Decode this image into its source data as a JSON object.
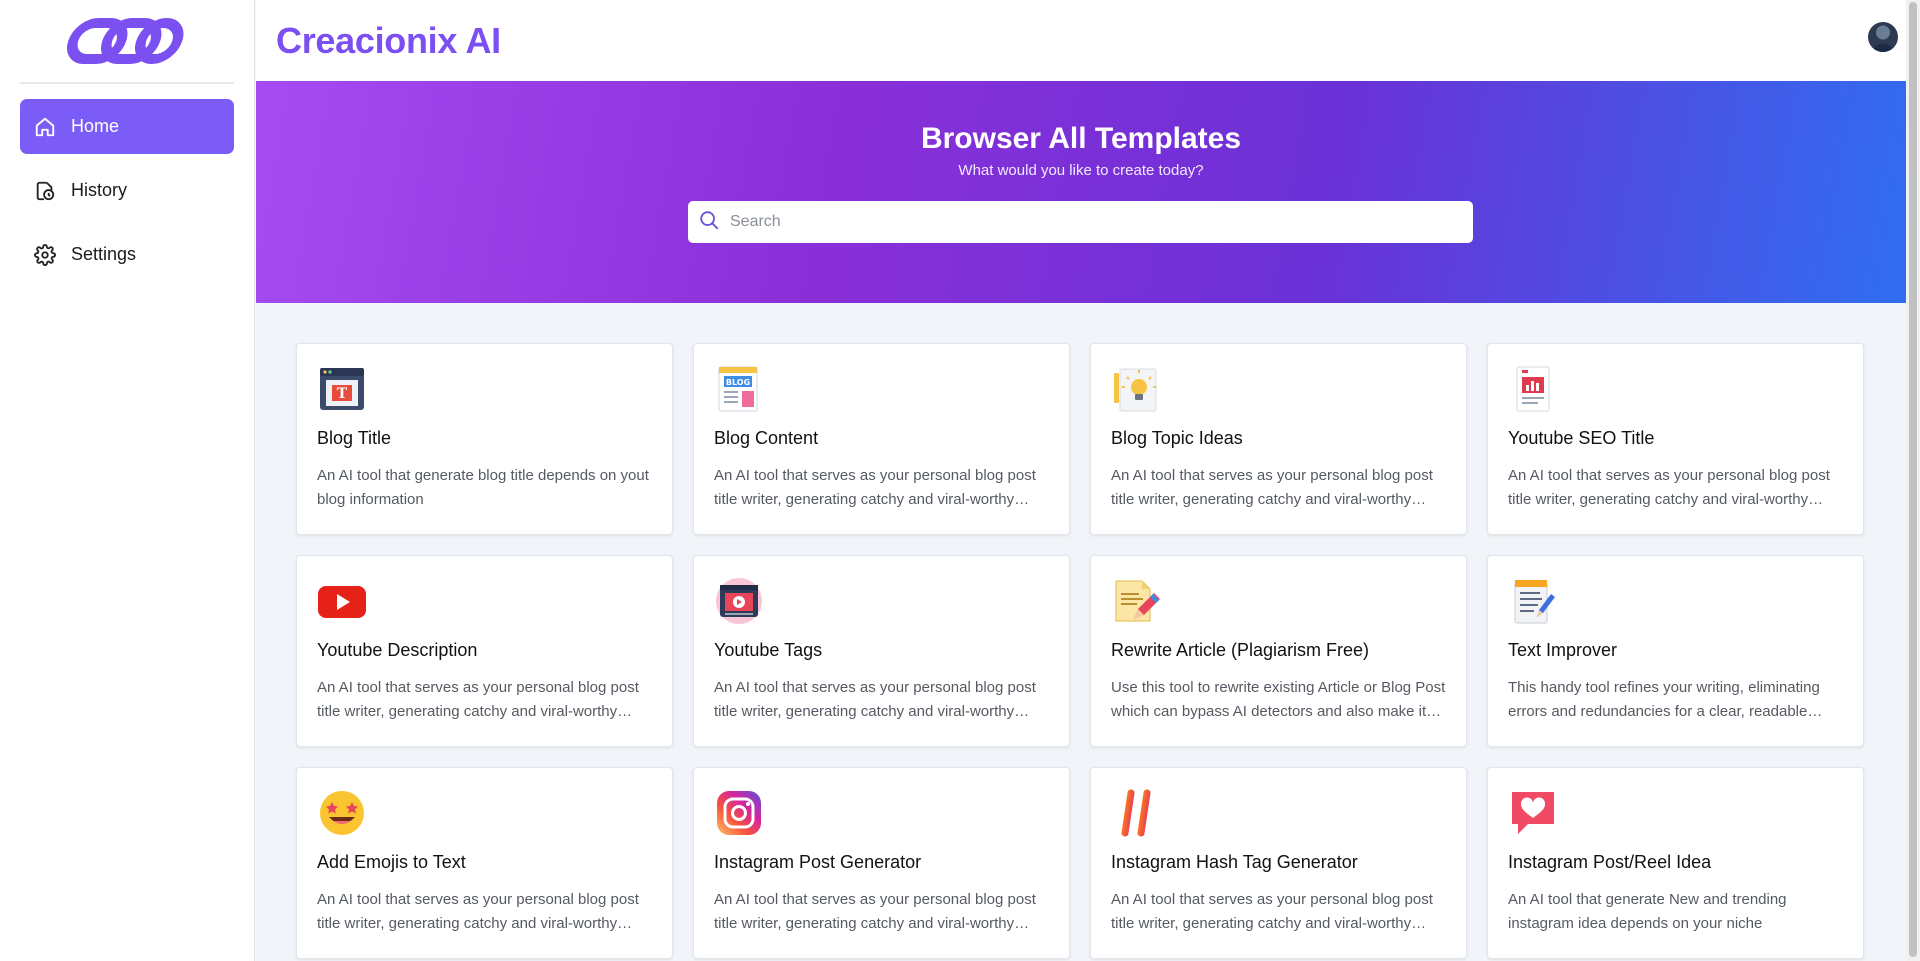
{
  "app": {
    "name": "Creacionix AI"
  },
  "sidebar": {
    "items": [
      {
        "label": "Home",
        "icon": "home-icon",
        "active": true
      },
      {
        "label": "History",
        "icon": "history-icon",
        "active": false
      },
      {
        "label": "Settings",
        "icon": "gear-icon",
        "active": false
      }
    ]
  },
  "hero": {
    "title": "Browser All Templates",
    "subtitle": "What would you like to create today?",
    "search_placeholder": "Search"
  },
  "templates": [
    {
      "title": "Blog Title",
      "desc": "An AI tool that generate blog title depends on yout blog information",
      "icon": "blog-title-icon"
    },
    {
      "title": "Blog Content",
      "desc": "An AI tool that serves as your personal blog post title writer, generating catchy and viral-worthy titles in your chosen language.",
      "icon": "blog-content-icon"
    },
    {
      "title": "Blog Topic Ideas",
      "desc": "An AI tool that serves as your personal blog post title writer, generating catchy and viral-worthy titles in your chosen language.",
      "icon": "lightbulb-icon"
    },
    {
      "title": "Youtube SEO Title",
      "desc": "An AI tool that serves as your personal blog post title writer, generating catchy and viral-worthy titles in your chosen language.",
      "icon": "seo-report-icon"
    },
    {
      "title": "Youtube Description",
      "desc": "An AI tool that serves as your personal blog post title writer, generating catchy and viral-worthy titles in your chosen language.",
      "icon": "youtube-icon"
    },
    {
      "title": "Youtube Tags",
      "desc": "An AI tool that serves as your personal blog post title writer, generating catchy and viral-worthy titles in your chosen language.",
      "icon": "video-tags-icon"
    },
    {
      "title": "Rewrite Article (Plagiarism Free)",
      "desc": "Use this tool to rewrite existing Article or Blog Post which can bypass AI detectors and also make it plagiarism free.",
      "icon": "pencil-document-icon"
    },
    {
      "title": "Text Improver",
      "desc": "This handy tool refines your writing, eliminating errors and redundancies for a clear, readable result.",
      "icon": "notepad-pencil-icon"
    },
    {
      "title": "Add Emojis to Text",
      "desc": "An AI tool that serves as your personal blog post title writer, generating catchy and viral-worthy titles in your chosen language.",
      "icon": "star-eyes-emoji-icon"
    },
    {
      "title": "Instagram Post Generator",
      "desc": "An AI tool that serves as your personal blog post title writer, generating catchy and viral-worthy titles in your chosen language.",
      "icon": "instagram-icon"
    },
    {
      "title": "Instagram Hash Tag Generator",
      "desc": "An AI tool that serves as your personal blog post title writer, generating catchy and viral-worthy titles in your chosen language.",
      "icon": "hashtag-icon"
    },
    {
      "title": "Instagram Post/Reel Idea",
      "desc": "An AI tool that generate New and trending instagram idea depends on your niche",
      "icon": "heart-chat-icon"
    }
  ],
  "colors": {
    "accent": "#7b5cf6",
    "brand": "#7b4ff0"
  }
}
